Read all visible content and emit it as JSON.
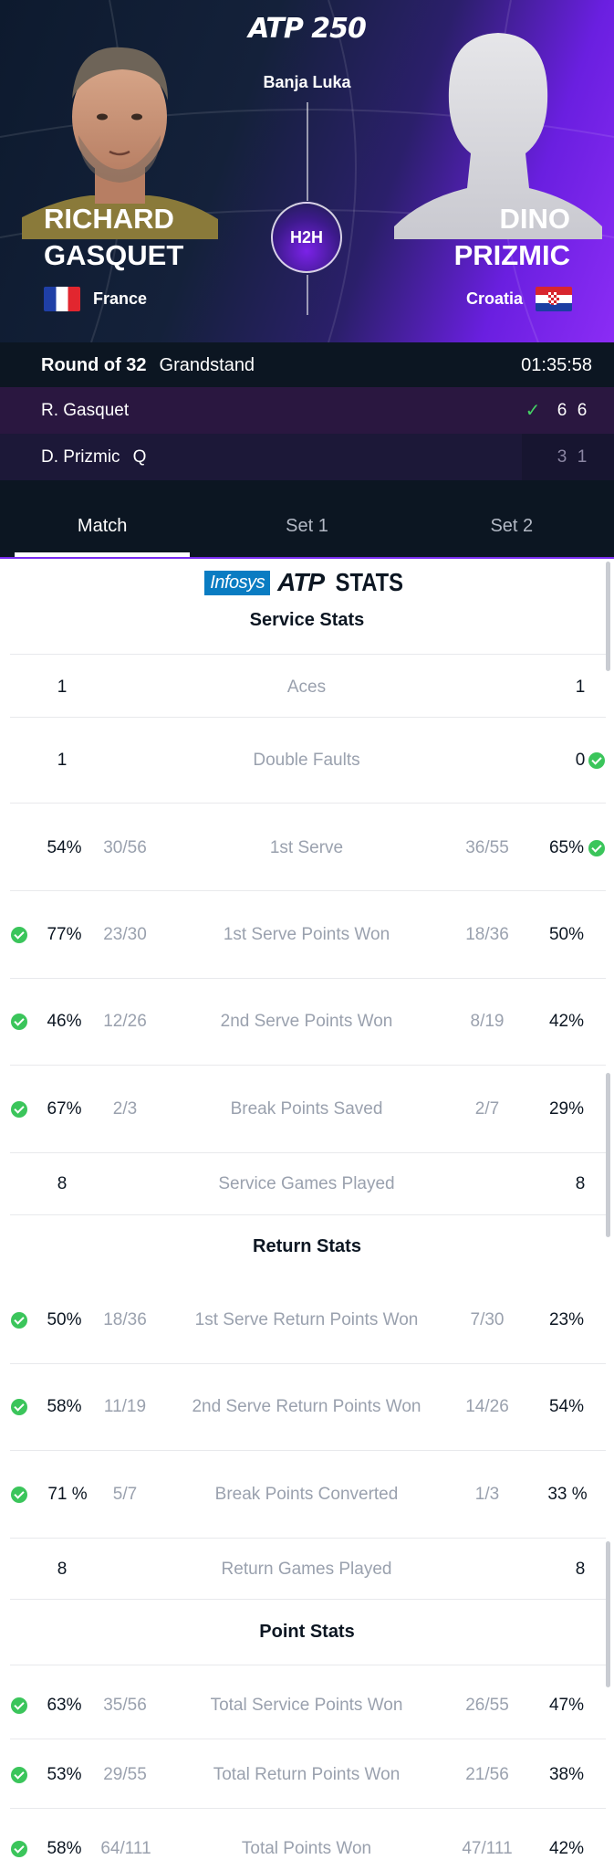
{
  "header": {
    "tournament_logo": "ATP 250",
    "location": "Banja Luka",
    "h2h_label": "H2H",
    "player_left": {
      "first": "RICHARD",
      "last": "GASQUET",
      "country": "France",
      "flag": "flag-france"
    },
    "player_right": {
      "first": "DINO",
      "last": "PRIZMIC",
      "country": "Croatia",
      "flag": "flag-croatia"
    }
  },
  "match": {
    "round": "Round of 32",
    "court": "Grandstand",
    "duration": "01:35:58",
    "rows": [
      {
        "name": "R. Gasquet",
        "qualifier": "",
        "winner": true,
        "sets": [
          "6",
          "6"
        ]
      },
      {
        "name": "D. Prizmic",
        "qualifier": "Q",
        "winner": false,
        "sets": [
          "3",
          "1"
        ]
      }
    ]
  },
  "tabs": [
    {
      "label": "Match",
      "active": true
    },
    {
      "label": "Set 1",
      "active": false
    },
    {
      "label": "Set 2",
      "active": false
    }
  ],
  "stats_logo": {
    "sponsor": "Infosys",
    "brand": "ATP",
    "word": "STATS"
  },
  "sections": {
    "service": "Service Stats",
    "return": "Return Stats",
    "point": "Point Stats"
  },
  "stats": {
    "aces": {
      "label": "Aces",
      "left": "1",
      "right": "1"
    },
    "double_faults": {
      "label": "Double Faults",
      "left": "1",
      "right": "0"
    },
    "first_serve": {
      "label": "1st Serve",
      "lpct": "54%",
      "lfrac": "30/56",
      "rfrac": "36/55",
      "rpct": "65%"
    },
    "first_serve_won": {
      "label": "1st Serve Points Won",
      "lpct": "77%",
      "lfrac": "23/30",
      "rfrac": "18/36",
      "rpct": "50%"
    },
    "second_serve_won": {
      "label": "2nd Serve Points Won",
      "lpct": "46%",
      "lfrac": "12/26",
      "rfrac": "8/19",
      "rpct": "42%"
    },
    "bp_saved": {
      "label": "Break Points Saved",
      "lpct": "67%",
      "lfrac": "2/3",
      "rfrac": "2/7",
      "rpct": "29%"
    },
    "service_games": {
      "label": "Service Games Played",
      "left": "8",
      "right": "8"
    },
    "first_return": {
      "label": "1st Serve Return Points Won",
      "lpct": "50%",
      "lfrac": "18/36",
      "rfrac": "7/30",
      "rpct": "23%"
    },
    "second_return": {
      "label": "2nd Serve Return Points Won",
      "lpct": "58%",
      "lfrac": "11/19",
      "rfrac": "14/26",
      "rpct": "54%"
    },
    "bp_converted": {
      "label": "Break Points Converted",
      "lpct": "71 %",
      "lfrac": "5/7",
      "rfrac": "1/3",
      "rpct": "33 %"
    },
    "return_games": {
      "label": "Return Games Played",
      "left": "8",
      "right": "8"
    },
    "total_service": {
      "label": "Total Service Points Won",
      "lpct": "63%",
      "lfrac": "35/56",
      "rfrac": "26/55",
      "rpct": "47%"
    },
    "total_return": {
      "label": "Total Return Points Won",
      "lpct": "53%",
      "lfrac": "29/55",
      "rfrac": "21/56",
      "rpct": "38%"
    },
    "total_points": {
      "label": "Total Points Won",
      "lpct": "58%",
      "lfrac": "64/111",
      "rfrac": "47/111",
      "rpct": "42%"
    }
  },
  "colors": {
    "accent_purple": "#7a2cf0",
    "check_green": "#3bc55b",
    "header_dark": "#0c1622"
  }
}
